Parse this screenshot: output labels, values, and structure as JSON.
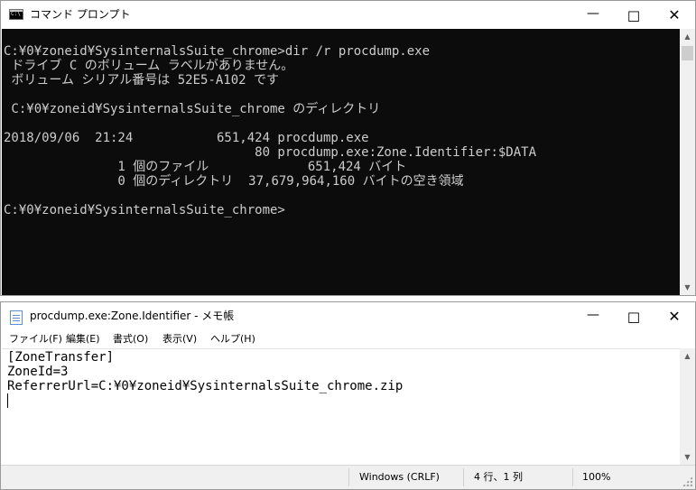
{
  "cmd_window": {
    "title": "コマンド プロンプト",
    "icon_text": "C:\\",
    "buttons": {
      "minimize": "—",
      "maximize": "☐",
      "close": "✕"
    },
    "console_lines": [
      "C:¥0¥zoneid¥SysinternalsSuite_chrome>dir /r procdump.exe",
      " ドライブ C のボリューム ラベルがありません。",
      " ボリューム シリアル番号は 52E5-A102 です",
      "",
      " C:¥0¥zoneid¥SysinternalsSuite_chrome のディレクトリ",
      "",
      "2018/09/06  21:24           651,424 procdump.exe",
      "                                 80 procdump.exe:Zone.Identifier:$DATA",
      "               1 個のファイル             651,424 バイト",
      "               0 個のディレクトリ  37,679,964,160 バイトの空き領域",
      "",
      "C:¥0¥zoneid¥SysinternalsSuite_chrome>"
    ]
  },
  "notepad_window": {
    "title": "procdump.exe:Zone.Identifier - メモ帳",
    "buttons": {
      "minimize": "—",
      "maximize": "☐",
      "close": "✕"
    },
    "menu": [
      "ファイル(F)",
      "編集(E)",
      "書式(O)",
      "表示(V)",
      "ヘルプ(H)"
    ],
    "content_lines": [
      "[ZoneTransfer]",
      "ZoneId=3",
      "ReferrerUrl=C:¥0¥zoneid¥SysinternalsSuite_chrome.zip"
    ],
    "status": {
      "line_ending": "Windows (CRLF)",
      "position": "4 行、1 列",
      "zoom": "100%"
    }
  },
  "colors": {
    "console_bg": "#0c0c0c",
    "console_text": "#cccccc",
    "chrome_bg": "#ffffff",
    "statusbar_bg": "#f0f0f0"
  }
}
